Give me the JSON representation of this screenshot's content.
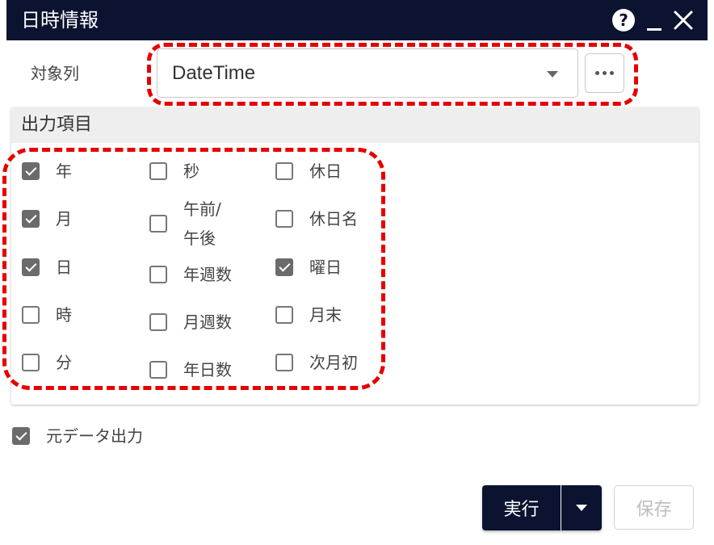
{
  "window": {
    "title": "日時情報",
    "help_icon": "question-circle-icon",
    "minimize_icon": "minimize-icon",
    "close_icon": "close-x-icon",
    "title_bar_color": "#0b1330"
  },
  "target_column": {
    "label": "対象列",
    "selected_value": "DateTime",
    "dropdown_icon": "caret-down-icon",
    "more_icon": "ellipsis-icon"
  },
  "output_items": {
    "header": "出力項目",
    "col1": [
      {
        "label": "年",
        "checked": true
      },
      {
        "label": "月",
        "checked": true
      },
      {
        "label": "日",
        "checked": true
      },
      {
        "label": "時",
        "checked": false
      },
      {
        "label": "分",
        "checked": false
      }
    ],
    "col2": [
      {
        "label": "秒",
        "checked": false
      },
      {
        "label": "午前/午後",
        "checked": false
      },
      {
        "label": "年週数",
        "checked": false
      },
      {
        "label": "月週数",
        "checked": false
      },
      {
        "label": "年日数",
        "checked": false
      }
    ],
    "col3": [
      {
        "label": "休日",
        "checked": false
      },
      {
        "label": "休日名",
        "checked": false
      },
      {
        "label": "曜日",
        "checked": true
      },
      {
        "label": "月末",
        "checked": false
      },
      {
        "label": "次月初",
        "checked": false
      }
    ]
  },
  "original_output": {
    "label": "元データ出力",
    "checked": true
  },
  "actions": {
    "run_label": "実行",
    "run_dropdown_icon": "caret-down-icon",
    "save_label": "保存",
    "save_disabled": true
  },
  "annotation_color": "#e60000"
}
